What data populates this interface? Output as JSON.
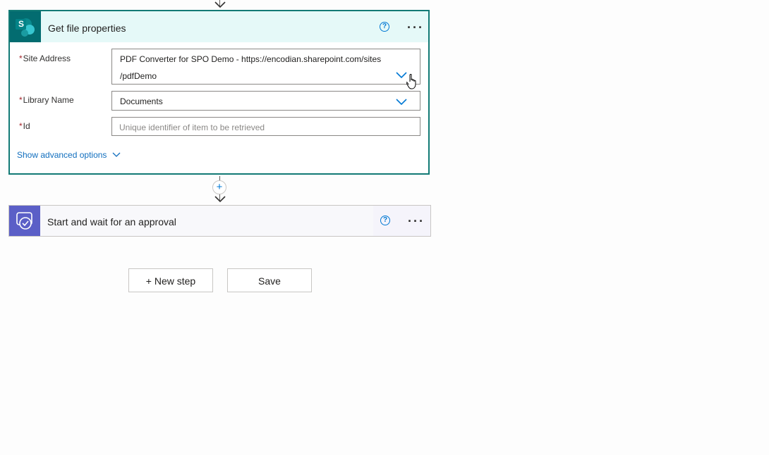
{
  "card1": {
    "title": "Get file properties",
    "help_glyph": "?",
    "more_glyph": "···",
    "fields": [
      {
        "required_mark": "*",
        "label": "Site Address",
        "value_line1": "PDF Converter for SPO Demo - https://encodian.sharepoint.com/sites",
        "value_line2": "/pdfDemo"
      },
      {
        "required_mark": "*",
        "label": "Library Name",
        "value": "Documents"
      },
      {
        "required_mark": "*",
        "label": "Id",
        "placeholder": "Unique identifier of item to be retrieved"
      }
    ],
    "advanced_label": "Show advanced options",
    "icon_letter": "S"
  },
  "card2": {
    "title": "Start and wait for an approval",
    "help_glyph": "?",
    "more_glyph": "···"
  },
  "actions": {
    "new_step_label": "+ New step",
    "save_label": "Save"
  },
  "insert_glyph": "+",
  "colors": {
    "sharepoint_teal": "#036c70",
    "card1_header": "#e5f9f8",
    "card1_border": "#127a75",
    "approvals_purple": "#5b5fc7",
    "link_blue": "#106ebe",
    "required_red": "#a4262c"
  }
}
